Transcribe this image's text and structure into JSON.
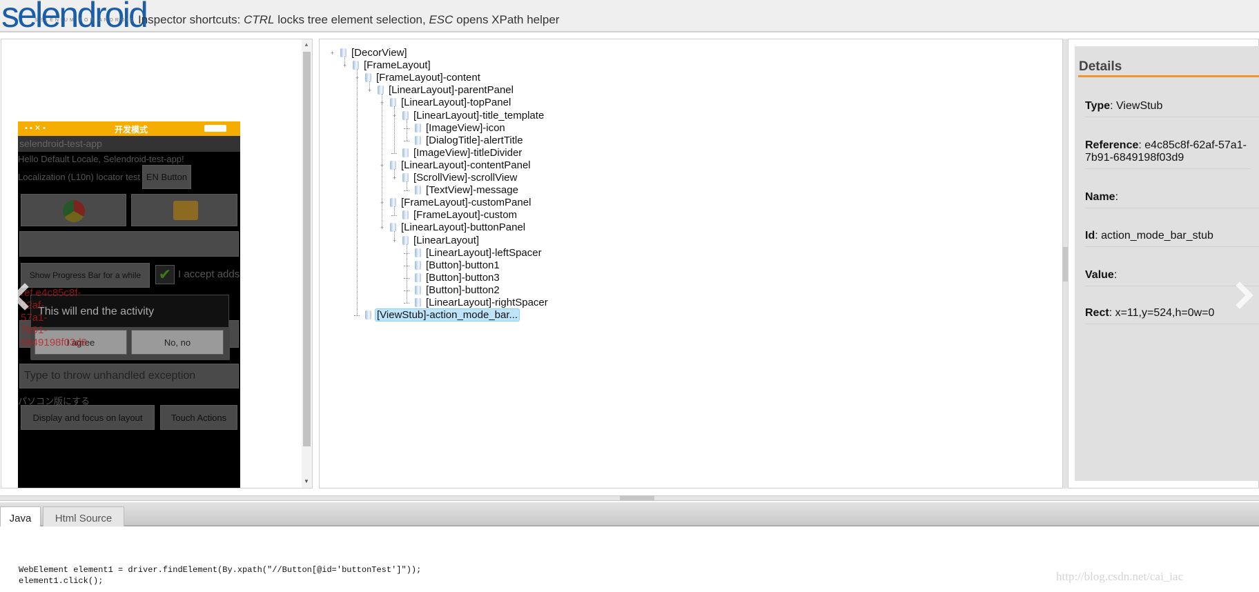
{
  "header": {
    "logo_text": "selendroid",
    "logo_subtitle": "SELENIUM FOR ANDROID",
    "shortcuts_prefix": "Inspector shortcuts: ",
    "key1": "CTRL",
    "text1": " locks tree element selection, ",
    "key2": "ESC",
    "text2": " opens XPath helper"
  },
  "device": {
    "status_title": "开发模式",
    "app_title": "selendroid-test-app",
    "hello_text": "Hello Default Locale, Selendroid-test-app!",
    "l10n_label": "Localization (L10n) locator test",
    "en_button": "EN Button",
    "progress_button": "Show Progress Bar for a while",
    "accept_label": "I accept adds",
    "dialog_title": "This will end the activity",
    "agree_button": "I agree",
    "no_button": "No, no",
    "exception_placeholder": "Type to throw unhandled exception",
    "japanese_text": "パソコン版にする",
    "display_button": "Display and focus on layout",
    "touch_button": "Touch Actions",
    "overlay_ref": [
      "ref e4c85c8f-",
      "62af-",
      "57a1-",
      "7b91-",
      "6849198f03d9"
    ]
  },
  "tree": {
    "selected": "[ViewStub]-action_mode_bar...",
    "nodes": [
      {
        "label": "[DecorView]",
        "level": 0,
        "expanded": true
      },
      {
        "label": "[FrameLayout]",
        "level": 1,
        "expanded": true
      },
      {
        "label": "[FrameLayout]-content",
        "level": 2,
        "expanded": true
      },
      {
        "label": "[LinearLayout]-parentPanel",
        "level": 3,
        "expanded": true
      },
      {
        "label": "[LinearLayout]-topPanel",
        "level": 4,
        "expanded": true
      },
      {
        "label": "[LinearLayout]-title_template",
        "level": 5,
        "expanded": true
      },
      {
        "label": "[ImageView]-icon",
        "level": 6
      },
      {
        "label": "[DialogTitle]-alertTitle",
        "level": 6
      },
      {
        "label": "[ImageView]-titleDivider",
        "level": 5
      },
      {
        "label": "[LinearLayout]-contentPanel",
        "level": 4,
        "expanded": true
      },
      {
        "label": "[ScrollView]-scrollView",
        "level": 5,
        "expanded": true
      },
      {
        "label": "[TextView]-message",
        "level": 6
      },
      {
        "label": "[FrameLayout]-customPanel",
        "level": 4,
        "expanded": true
      },
      {
        "label": "[FrameLayout]-custom",
        "level": 5
      },
      {
        "label": "[LinearLayout]-buttonPanel",
        "level": 4,
        "expanded": true
      },
      {
        "label": "[LinearLayout]",
        "level": 5,
        "expanded": true
      },
      {
        "label": "[LinearLayout]-leftSpacer",
        "level": 6
      },
      {
        "label": "[Button]-button1",
        "level": 6
      },
      {
        "label": "[Button]-button3",
        "level": 6
      },
      {
        "label": "[Button]-button2",
        "level": 6
      },
      {
        "label": "[LinearLayout]-rightSpacer",
        "level": 6
      },
      {
        "label": "[ViewStub]-action_mode_bar...",
        "level": 2,
        "selected": true
      }
    ]
  },
  "details": {
    "title": "Details",
    "rows": [
      {
        "key": "Type",
        "value": "ViewStub"
      },
      {
        "key": "Reference",
        "value": "e4c85c8f-62af-57a1-7b91-6849198f03d9"
      },
      {
        "key": "Name",
        "value": ""
      },
      {
        "key": "Id",
        "value": "action_mode_bar_stub"
      },
      {
        "key": "Value",
        "value": ""
      },
      {
        "key": "Rect",
        "value": "x=11,y=524,h=0w=0"
      }
    ],
    "accent_color": "#f7931e"
  },
  "bottom": {
    "tabs": [
      {
        "label": "Java",
        "active": true
      },
      {
        "label": "Html Source",
        "active": false
      }
    ],
    "code_lines": [
      "WebElement element1 = driver.findElement(By.xpath(\"//Button[@id='buttonTest']\"));",
      "element1.click();"
    ]
  },
  "watermark": "http://blog.csdn.net/cai_iac"
}
